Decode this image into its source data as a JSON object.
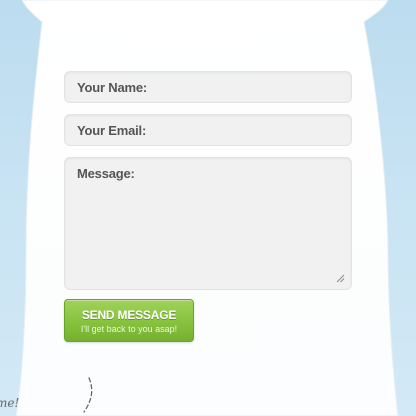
{
  "form": {
    "name_label": "Your Name:",
    "email_label": "Your Email:",
    "message_label": "Message:"
  },
  "send_button": {
    "label": "SEND MESSAGE",
    "sub_label": "I'll get back to you asap!"
  },
  "doodle": {
    "handwriting": "me!"
  },
  "colors": {
    "background": "#c8e3f3",
    "card": "#ffffff",
    "button": "#87c23f"
  },
  "icons": [
    "resize-handle-icon",
    "dashed-arrow-icon"
  ]
}
